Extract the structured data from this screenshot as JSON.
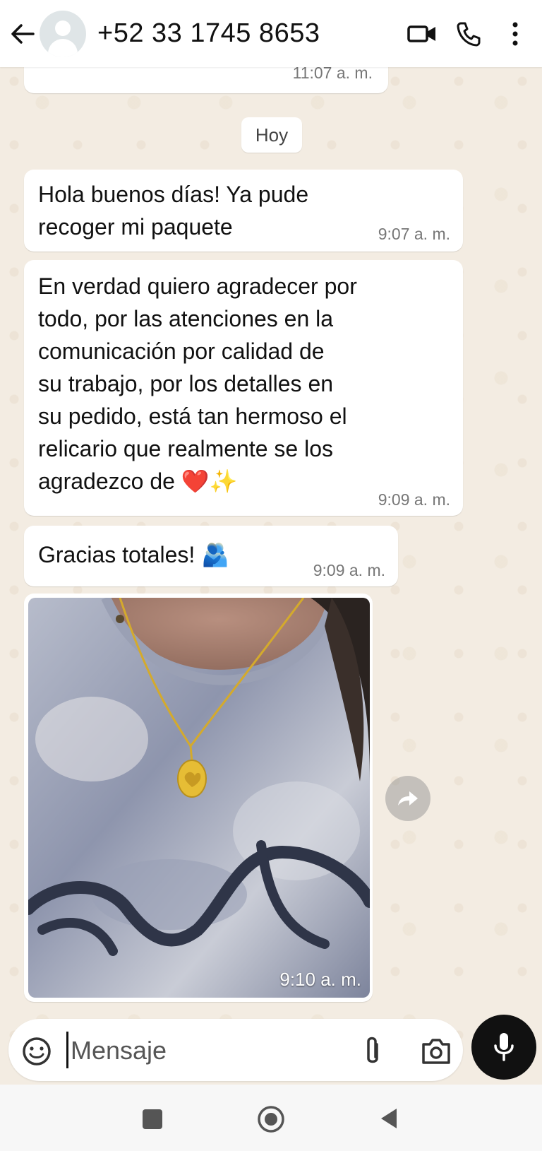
{
  "header": {
    "contact_name": "+52 33 1745 8653",
    "icons": [
      "arrow-left-icon",
      "avatar",
      "video-call-icon",
      "phone-icon",
      "more-vertical-icon"
    ]
  },
  "date_chip": "Hoy",
  "messages": [
    {
      "text": "",
      "time": "11:07 a. m."
    },
    {
      "text": "Hola buenos días! Ya pude\nrecoger mi paquete",
      "time": "9:07 a. m."
    },
    {
      "text": "En verdad quiero agradecer por\ntodo, por las atenciones en la\ncomunicación por calidad de\nsu trabajo, por los detalles en\nsu pedido, está tan hermoso el\nrelicario que realmente se los\nagradezco de ❤️✨",
      "time": "9:09 a. m."
    },
    {
      "text": "Gracias totales! 🫂",
      "time": "9:09 a. m."
    }
  ],
  "photo_message": {
    "time": "9:10 a. m."
  },
  "composer": {
    "placeholder": "Mensaje"
  },
  "colors": {
    "chat_bg": "#f3ece2",
    "bubble": "#ffffff",
    "mic_button": "#111111"
  }
}
